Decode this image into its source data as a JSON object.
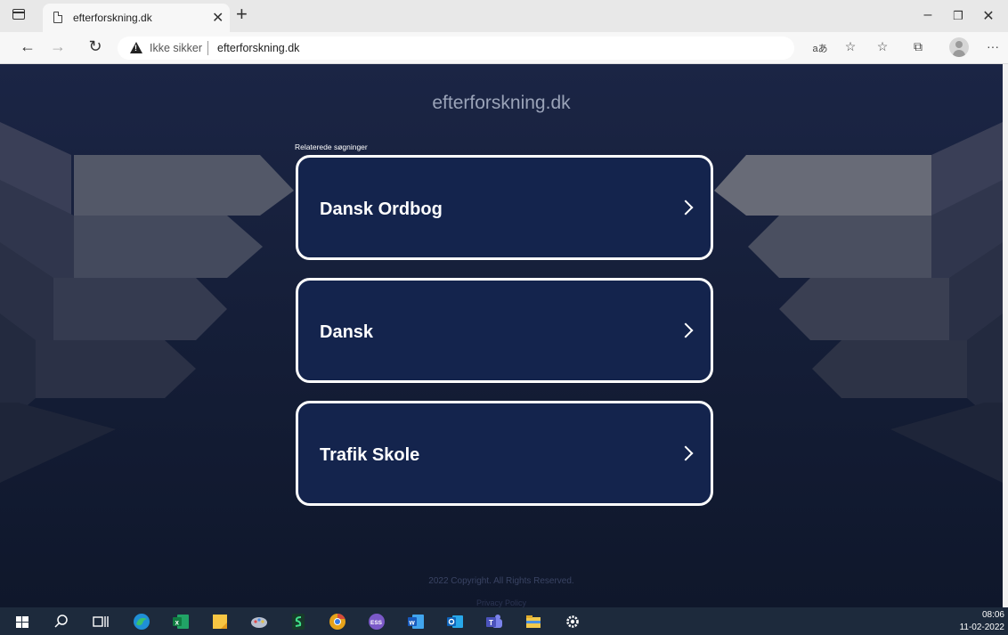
{
  "browser": {
    "tab": {
      "title": "efterforskning.dk"
    },
    "address": {
      "security_label": "Ikke sikker",
      "url": "efterforskning.dk"
    }
  },
  "page": {
    "site_title": "efterforskning.dk",
    "related_label": "Relaterede søgninger",
    "cards": [
      {
        "label": "Dansk Ordbog"
      },
      {
        "label": "Dansk"
      },
      {
        "label": "Trafik Skole"
      }
    ],
    "copyright": "2022 Copyright. All Rights Reserved.",
    "privacy_link": "Privacy Policy"
  },
  "taskbar": {
    "time": "08:06",
    "date": "11-02-2022",
    "apps": [
      "windows-start",
      "search",
      "task-view",
      "edge",
      "excel",
      "sticky-notes",
      "paint",
      "scanner",
      "chrome",
      "ess",
      "word",
      "outlook",
      "teams",
      "file-explorer",
      "settings"
    ]
  },
  "colors": {
    "page_bg": "#141d36",
    "card_bg": "#14244d",
    "card_border": "#ffffff",
    "taskbar_bg": "#1d2a3c"
  }
}
